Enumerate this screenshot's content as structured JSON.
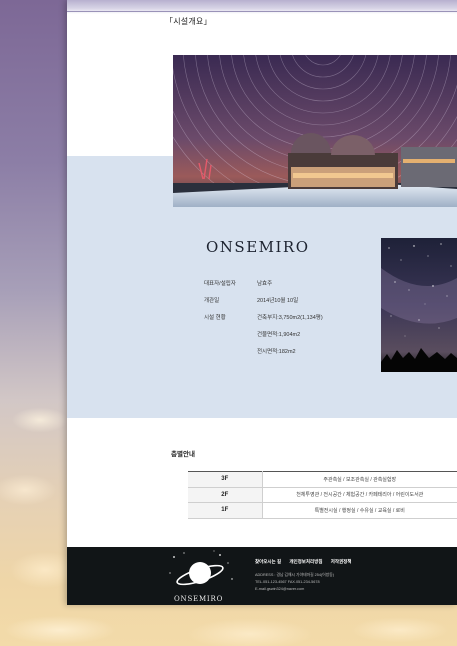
{
  "section": {
    "title": "「시설개요」"
  },
  "brand": {
    "name": "ONSEMIRO"
  },
  "info": [
    {
      "label": "대표자/설립자",
      "value": "남효주"
    },
    {
      "label": "개관일",
      "value": "2014년10월 10일"
    },
    {
      "label": "시설 현황",
      "value": "건축부지:3,750m2(1,134평)"
    },
    {
      "label": "",
      "value": "건물면적:1,904m2"
    },
    {
      "label": "",
      "value": "전시면적:182m2"
    }
  ],
  "floors": {
    "title": "층별안내",
    "rows": [
      {
        "floor": "3F",
        "desc": "주관측실 / 보조관측실 / 관측실험장"
      },
      {
        "floor": "2F",
        "desc": "천체투영관 / 전시공간 / 체험공간 / 카페테리아 / 어린이도서관"
      },
      {
        "floor": "1F",
        "desc": "특별전시실 / 행정실 / 수유실 / 교육실 / 로비"
      }
    ]
  },
  "footer": {
    "links": [
      "찾아오시는 길",
      "개인정보처리방침",
      "저작권정책"
    ],
    "address": "ADDRESS : 경남 김해시 가야테마길 254(어방동)",
    "contact": "TEL.051-123-4567    FAX.051-234-5678",
    "email": "E-mail.gswin324@naver.com",
    "logo_text": "ONSEMIRO"
  },
  "colors": {
    "band": "#d8e2ef",
    "footer_bg": "#111517",
    "page_bg": "#ffffff"
  }
}
